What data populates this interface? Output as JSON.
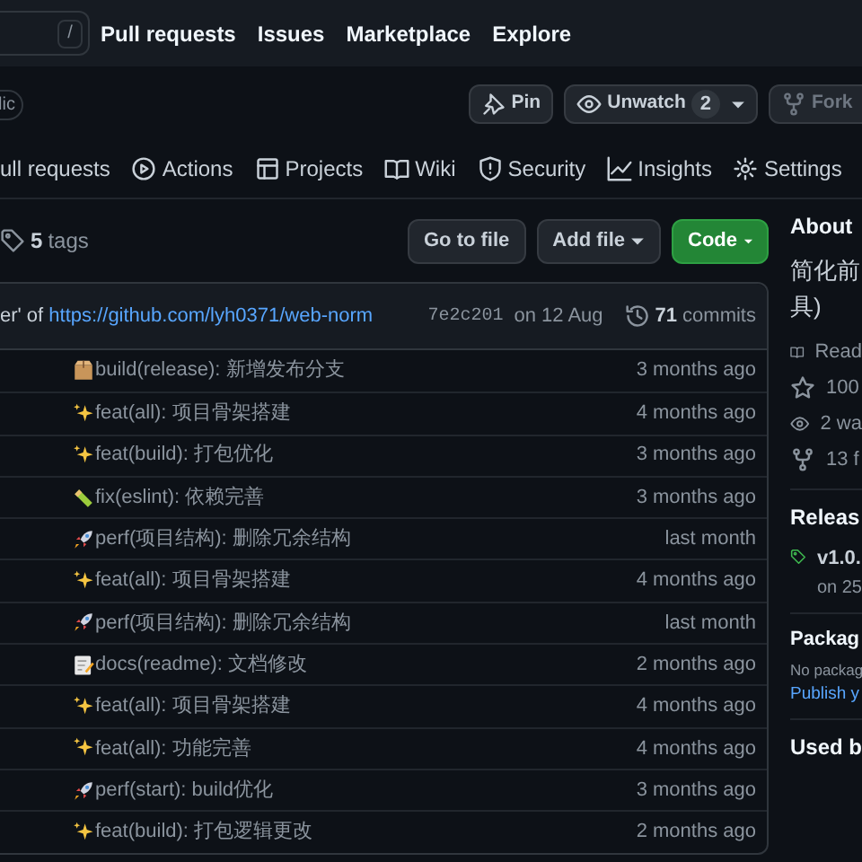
{
  "top_nav": {
    "search_key": "/",
    "links": [
      "Pull requests",
      "Issues",
      "Marketplace",
      "Explore"
    ]
  },
  "repo_header": {
    "visibility": "lic",
    "buttons": [
      {
        "kind": "pin",
        "label": "Pin",
        "disabled": false
      },
      {
        "kind": "watch",
        "label": "Unwatch",
        "count": "2",
        "disabled": false
      },
      {
        "kind": "fork",
        "label": "Fork",
        "disabled": true
      }
    ]
  },
  "tabs": [
    {
      "kind": "pr",
      "label": "ull requests",
      "selected": false
    },
    {
      "kind": "actions",
      "label": "Actions",
      "selected": false
    },
    {
      "kind": "projects",
      "label": "Projects",
      "selected": false
    },
    {
      "kind": "wiki",
      "label": "Wiki",
      "selected": false
    },
    {
      "kind": "security",
      "label": "Security",
      "selected": false
    },
    {
      "kind": "insights",
      "label": "Insights",
      "selected": false
    },
    {
      "kind": "settings",
      "label": "Settings",
      "selected": false
    }
  ],
  "toolbar": {
    "tags_count": "5",
    "tags_label": "tags",
    "go_to_file": "Go to file",
    "add_file": "Add file",
    "code": "Code"
  },
  "latest_commit": {
    "message": "er' of ",
    "link": "https://github.com/lyh0371/web-norm",
    "sha": "7e2c201",
    "date": "on 12 Aug",
    "commits_count": "71",
    "commits_label": "commits"
  },
  "files": [
    {
      "kind": "package",
      "message": "build(release): 新增发布分支",
      "age": "3 months ago"
    },
    {
      "kind": "sparkles",
      "message": "feat(all): 项目骨架搭建",
      "age": "4 months ago"
    },
    {
      "kind": "sparkles",
      "message": "feat(build): 打包优化",
      "age": "3 months ago"
    },
    {
      "kind": "stick",
      "message": "fix(eslint): 依赖完善",
      "age": "3 months ago"
    },
    {
      "kind": "rocket",
      "message": "perf(项目结构): 删除冗余结构",
      "age": "last month"
    },
    {
      "kind": "sparkles",
      "message": "feat(all): 项目骨架搭建",
      "age": "4 months ago"
    },
    {
      "kind": "rocket",
      "message": "perf(项目结构): 删除冗余结构",
      "age": "last month"
    },
    {
      "kind": "memo",
      "message": "docs(readme): 文档修改",
      "age": "2 months ago"
    },
    {
      "kind": "sparkles",
      "message": "feat(all): 项目骨架搭建",
      "age": "4 months ago"
    },
    {
      "kind": "sparkles",
      "message": "feat(all): 功能完善",
      "age": "4 months ago"
    },
    {
      "kind": "rocket",
      "message": "perf(start): build优化",
      "age": "3 months ago"
    },
    {
      "kind": "sparkles",
      "message": "feat(build): 打包逻辑更改",
      "age": "2 months ago"
    }
  ],
  "sidebar": {
    "about_title": "About",
    "description": [
      "简化前",
      "具)"
    ],
    "stats": [
      {
        "kind": "book",
        "label": "Read"
      },
      {
        "kind": "star",
        "label": "100"
      },
      {
        "kind": "eye",
        "label": "2 wa"
      },
      {
        "kind": "fork",
        "label": "13 f"
      }
    ],
    "releases_title": "Releas",
    "release": {
      "name": "v1.0.",
      "date": "on 25"
    },
    "packages_title": "Packag",
    "packages_text": "No packag",
    "packages_link": "Publish y",
    "used_by_title": "Used b"
  }
}
